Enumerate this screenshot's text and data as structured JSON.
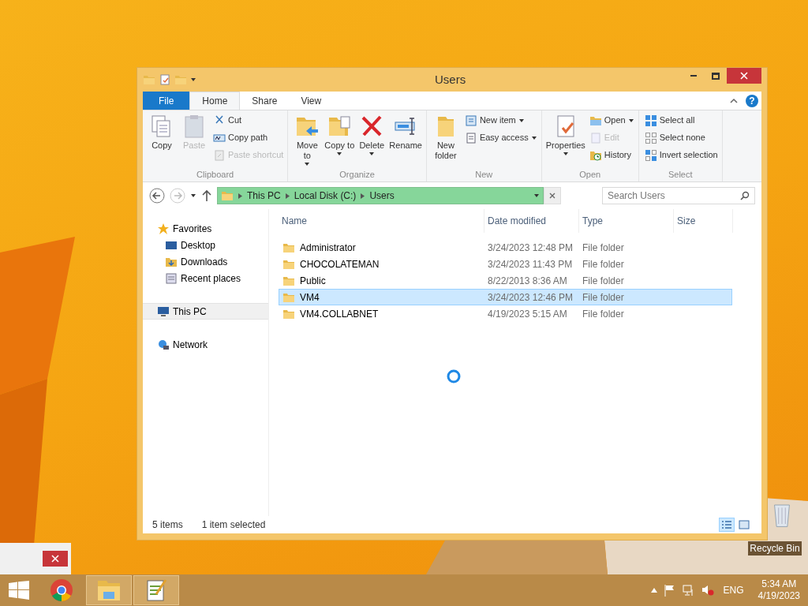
{
  "window": {
    "title": "Users"
  },
  "ribbon_help": {
    "label": "?"
  },
  "ribbon_tabs": [
    {
      "label": "File",
      "kind": "file",
      "selected": false
    },
    {
      "label": "Home",
      "kind": "tab",
      "selected": true
    },
    {
      "label": "Share",
      "kind": "tab",
      "selected": false
    },
    {
      "label": "View",
      "kind": "tab",
      "selected": false
    }
  ],
  "ribbon_groups": [
    {
      "label": "Clipboard",
      "large": [
        {
          "label": "Copy",
          "disabled": false,
          "dropdown": false
        },
        {
          "label": "Paste",
          "disabled": true,
          "dropdown": false
        }
      ],
      "small": [
        {
          "label": "Cut",
          "disabled": false,
          "dropdown": false
        },
        {
          "label": "Copy path",
          "disabled": false,
          "dropdown": false
        },
        {
          "label": "Paste shortcut",
          "disabled": true,
          "dropdown": false
        }
      ]
    },
    {
      "label": "Organize",
      "large": [
        {
          "label": "Move to",
          "disabled": false,
          "dropdown": true
        },
        {
          "label": "Copy to",
          "disabled": false,
          "dropdown": true
        },
        {
          "label": "Delete",
          "disabled": false,
          "dropdown": true
        },
        {
          "label": "Rename",
          "disabled": false,
          "dropdown": false
        }
      ]
    },
    {
      "label": "New",
      "large": [
        {
          "label": "New folder",
          "disabled": false,
          "dropdown": false
        }
      ],
      "small": [
        {
          "label": "New item",
          "disabled": false,
          "dropdown": true
        },
        {
          "label": "Easy access",
          "disabled": false,
          "dropdown": true
        }
      ]
    },
    {
      "label": "Open",
      "large": [
        {
          "label": "Properties",
          "disabled": false,
          "dropdown": true
        }
      ],
      "small": [
        {
          "label": "Open",
          "disabled": false,
          "dropdown": true
        },
        {
          "label": "Edit",
          "disabled": true,
          "dropdown": false
        },
        {
          "label": "History",
          "disabled": false,
          "dropdown": false
        }
      ]
    },
    {
      "label": "Select",
      "small": [
        {
          "label": "Select all",
          "disabled": false,
          "dropdown": false
        },
        {
          "label": "Select none",
          "disabled": false,
          "dropdown": false
        },
        {
          "label": "Invert selection",
          "disabled": false,
          "dropdown": false
        }
      ]
    }
  ],
  "address": {
    "path": [
      "This PC",
      "Local Disk (C:)",
      "Users"
    ]
  },
  "search": {
    "placeholder": "Search Users"
  },
  "nav_pane": [
    {
      "label": "Favorites",
      "selected": false,
      "children": [
        {
          "label": "Desktop",
          "selected": false
        },
        {
          "label": "Downloads",
          "selected": false
        },
        {
          "label": "Recent places",
          "selected": false
        }
      ]
    },
    {
      "label": "This PC",
      "selected": true
    },
    {
      "label": "Network",
      "selected": false
    }
  ],
  "table": {
    "columns": [
      "Name",
      "Date modified",
      "Type",
      "Size"
    ],
    "rows": [
      {
        "name": "Administrator",
        "date": "3/24/2023 12:48 PM",
        "type": "File folder",
        "selected": false
      },
      {
        "name": "CHOCOLATEMAN",
        "date": "3/24/2023 11:43 PM",
        "type": "File folder",
        "selected": false
      },
      {
        "name": "Public",
        "date": "8/22/2013 8:36 AM",
        "type": "File folder",
        "selected": false
      },
      {
        "name": "VM4",
        "date": "3/24/2023 12:46 PM",
        "type": "File folder",
        "selected": true
      },
      {
        "name": "VM4.COLLABNET",
        "date": "4/19/2023 5:15 AM",
        "type": "File folder",
        "selected": false
      }
    ]
  },
  "status_bar": {
    "items": "5 items",
    "selection": "1 item selected"
  },
  "view_buttons": [
    {
      "kind": "details",
      "selected": true
    },
    {
      "kind": "thumbnails",
      "selected": false
    }
  ],
  "desktop_icons": [
    {
      "label": "Recycle Bin"
    }
  ],
  "taskbar": {
    "apps": [
      {
        "kind": "browser",
        "open": false
      },
      {
        "kind": "explorer",
        "open": true
      },
      {
        "kind": "editor",
        "open": true
      }
    ],
    "language": "ENG",
    "time": "5:34 AM",
    "date": "4/19/2023"
  }
}
